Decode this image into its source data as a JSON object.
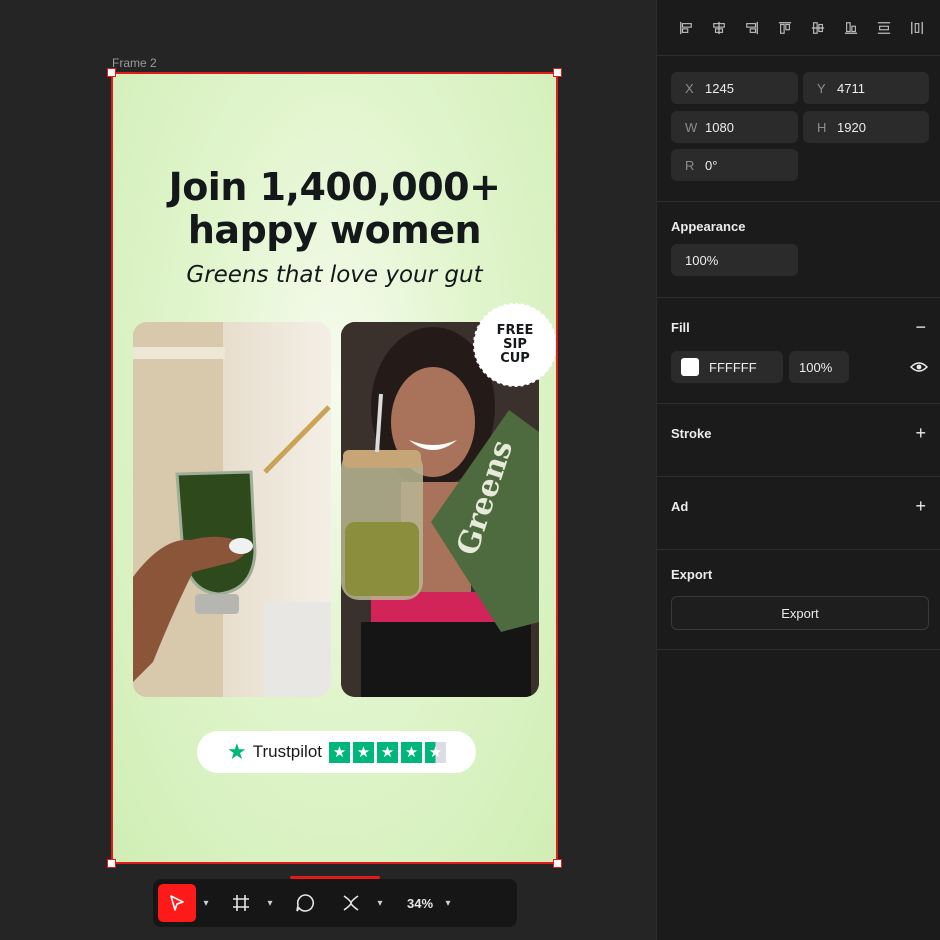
{
  "canvas": {
    "frame_label": "Frame 2",
    "ad": {
      "headline_line1": "Join 1,400,000+",
      "headline_line2": "happy women",
      "subheadline": "Greens that love your gut",
      "badge_lines": [
        "FREE",
        "SIP",
        "CUP"
      ],
      "trust_brand": "Trustpilot",
      "trust_rating_stars": 4.5,
      "background_color": "#d7f2c0"
    }
  },
  "toolbar": {
    "zoom": "34%",
    "tools": [
      "select-tool",
      "frame-tool",
      "shape-tool",
      "pen-tool"
    ],
    "accent_color": "#ff1a1a"
  },
  "panel": {
    "align_tools": [
      "align-left",
      "align-center-horizontal",
      "align-right",
      "align-top",
      "align-center-vertical",
      "align-bottom",
      "distribute-vertical",
      "distribute-horizontal"
    ],
    "position": {
      "x_label": "X",
      "x": "1245",
      "y_label": "Y",
      "y": "4711",
      "w_label": "W",
      "w": "1080",
      "h_label": "H",
      "h": "1920",
      "r_label": "R",
      "r": "0°"
    },
    "appearance": {
      "title": "Appearance",
      "opacity": "100%"
    },
    "fill": {
      "title": "Fill",
      "hex": "FFFFFF",
      "opacity": "100%",
      "color": "#ffffff"
    },
    "stroke": {
      "title": "Stroke"
    },
    "ad": {
      "title": "Ad"
    },
    "export": {
      "title": "Export",
      "button": "Export"
    }
  }
}
